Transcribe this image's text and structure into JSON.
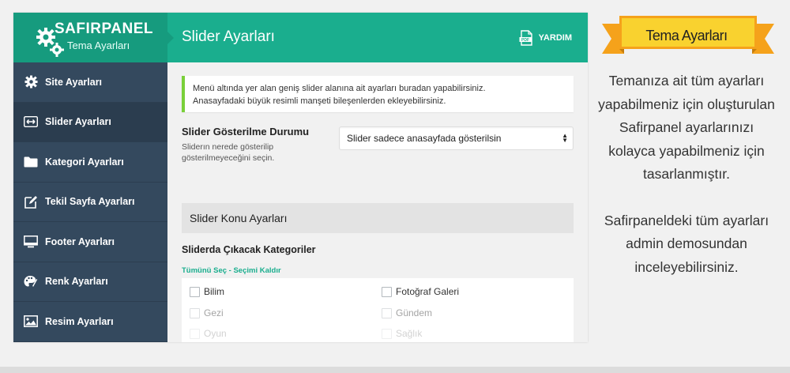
{
  "brand": {
    "name": "SAFIRPANEL",
    "subtitle": "Tema Ayarları"
  },
  "header": {
    "title": "Slider Ayarları",
    "help_label": "YARDIM"
  },
  "sidebar": {
    "items": [
      {
        "label": "Site Ayarları",
        "icon": "gear-icon"
      },
      {
        "label": "Slider Ayarları",
        "icon": "arrows-horizontal-icon",
        "active": true
      },
      {
        "label": "Kategori Ayarları",
        "icon": "folder-icon"
      },
      {
        "label": "Tekil Sayfa Ayarları",
        "icon": "edit-icon"
      },
      {
        "label": "Footer Ayarları",
        "icon": "monitor-icon"
      },
      {
        "label": "Renk Ayarları",
        "icon": "palette-icon"
      },
      {
        "label": "Resim Ayarları",
        "icon": "image-icon"
      }
    ]
  },
  "notice": {
    "line1": "Menü altında yer alan geniş slider alanına ait ayarları buradan yapabilirsiniz.",
    "line2": "Anasayfadaki büyük resimli manşeti bileşenlerden ekleyebilirsiniz."
  },
  "slider_display": {
    "label": "Slider Gösterilme Durumu",
    "description": "Sliderın nerede gösterilip gösterilmeyeceğini seçin.",
    "selected": "Slider sadece anasayfada gösterilsin"
  },
  "section": {
    "title": "Slider Konu Ayarları"
  },
  "categories": {
    "label": "Sliderda Çıkacak Kategoriler",
    "select_all": "Tümünü Seç",
    "separator": " - ",
    "deselect": "Seçimi Kaldır",
    "items": [
      "Bilim",
      "Fotoğraf Galeri",
      "Gezi",
      "Gündem",
      "Oyun",
      "Sağlık"
    ]
  },
  "promo": {
    "ribbon": "Tema Ayarları",
    "paragraph1": "Temanıza ait tüm ayarları yapabilmeniz için oluşturulan Safirpanel ayarlarınızı kolayca yapabilmeniz için tasarlanmıştır.",
    "paragraph2": "Safirpaneldeki tüm ayarları admin demosundan inceleyebilirsiniz."
  },
  "colors": {
    "header": "#1aae8e",
    "sidebar": "#34495e",
    "ribbon": "#f5a21b",
    "ribbon_inner": "#f9d22f",
    "notice_border": "#7ad03a"
  }
}
